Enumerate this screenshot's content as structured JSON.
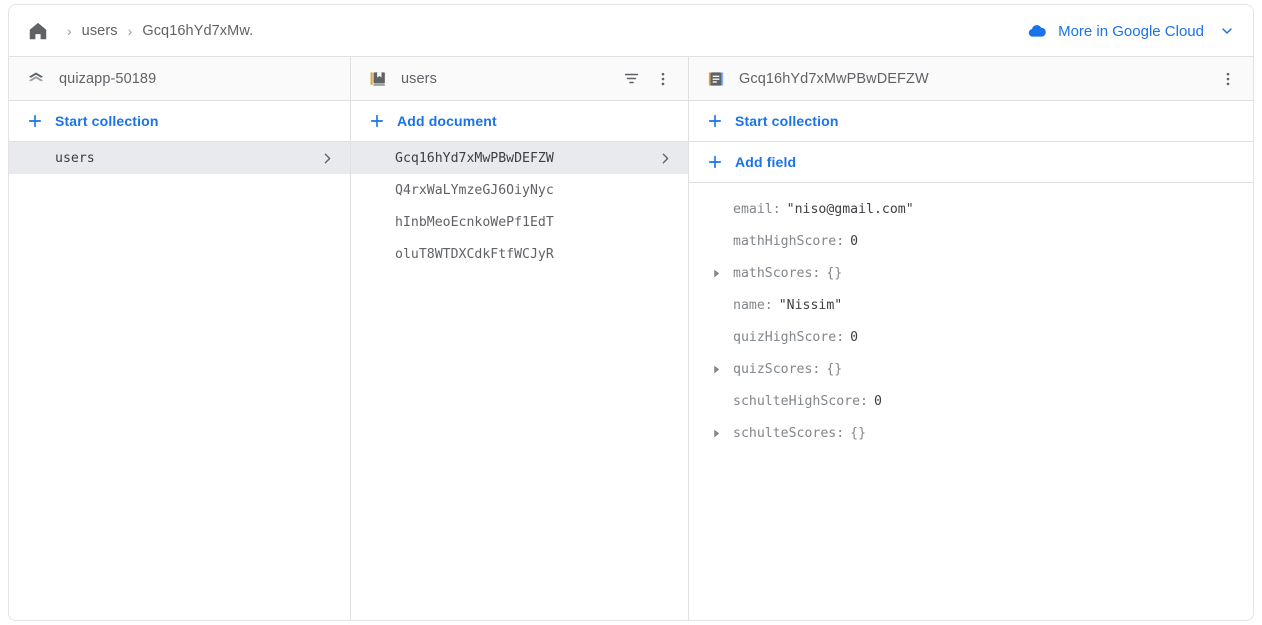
{
  "breadcrumb": {
    "home_icon": "home-icon",
    "separator": "›",
    "items": [
      {
        "label": "users"
      },
      {
        "label": "Gcq16hYd7xMw."
      }
    ]
  },
  "header": {
    "cloud_icon": "cloud-icon",
    "more_in_google_cloud": "More in Google Cloud",
    "chevron_icon": "chevron-down-icon"
  },
  "colors": {
    "accent_blue": "#1a73e8",
    "text_gray": "#5f6368",
    "key_gray": "#80868b",
    "selected_row_bg": "#e8eaed",
    "panel_head_bg": "#fafafa",
    "border": "#e0e0e0"
  },
  "panels": {
    "database": {
      "icon": "firestore-database-icon",
      "title": "quizapp-50189",
      "action": {
        "icon": "plus-icon",
        "label": "Start collection"
      },
      "rows": [
        {
          "label": "users",
          "selected": true,
          "chevron": "chevron-right-icon"
        }
      ]
    },
    "collection": {
      "icon": "collection-icon",
      "title": "users",
      "actions": [
        {
          "icon": "filter-icon",
          "name": "filter-button"
        },
        {
          "icon": "more-vert-icon",
          "name": "collection-overflow-menu"
        }
      ],
      "action": {
        "icon": "plus-icon",
        "label": "Add document"
      },
      "rows": [
        {
          "label": "Gcq16hYd7xMwPBwDEFZW",
          "selected": true,
          "chevron": "chevron-right-icon"
        },
        {
          "label": "Q4rxWaLYmzeGJ6OiyNyc",
          "selected": false
        },
        {
          "label": "hInbMeoEcnkoWePf1EdT",
          "selected": false
        },
        {
          "label": "oluT8WTDXCdkFtfWCJyR",
          "selected": false
        }
      ]
    },
    "document": {
      "icon": "document-icon",
      "title": "Gcq16hYd7xMwPBwDEFZW",
      "actions": [
        {
          "icon": "more-vert-icon",
          "name": "document-overflow-menu"
        }
      ],
      "action_start_collection": {
        "icon": "plus-icon",
        "label": "Start collection"
      },
      "action_add_field": {
        "icon": "plus-icon",
        "label": "Add field"
      },
      "fields": [
        {
          "key": "email",
          "colon": ":",
          "value": "\"niso@gmail.com\"",
          "expandable": false,
          "muted": false
        },
        {
          "key": "mathHighScore",
          "colon": ":",
          "value": "0",
          "expandable": false,
          "muted": false
        },
        {
          "key": "mathScores",
          "colon": ":",
          "value": "{}",
          "expandable": true,
          "muted": true
        },
        {
          "key": "name",
          "colon": ":",
          "value": "\"Nissim\"",
          "expandable": false,
          "muted": false
        },
        {
          "key": "quizHighScore",
          "colon": ":",
          "value": "0",
          "expandable": false,
          "muted": false
        },
        {
          "key": "quizScores",
          "colon": ":",
          "value": "{}",
          "expandable": true,
          "muted": true
        },
        {
          "key": "schulteHighScore",
          "colon": ":",
          "value": "0",
          "expandable": false,
          "muted": false
        },
        {
          "key": "schulteScores",
          "colon": ":",
          "value": "{}",
          "expandable": true,
          "muted": true
        }
      ]
    }
  }
}
